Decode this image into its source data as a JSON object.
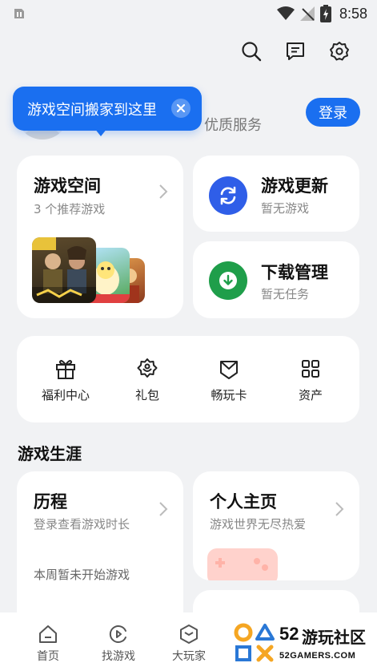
{
  "status_bar": {
    "time": "8:58"
  },
  "profile": {
    "tagline": "优质服务",
    "login_label": "登录"
  },
  "tooltip": {
    "text": "游戏空间搬家到这里"
  },
  "game_space": {
    "title": "游戏空间",
    "subtitle": "3 个推荐游戏"
  },
  "game_update": {
    "title": "游戏更新",
    "subtitle": "暂无游戏",
    "accent": "#2f5ee8"
  },
  "download_mgmt": {
    "title": "下载管理",
    "subtitle": "暂无任务",
    "accent": "#1f9e4a"
  },
  "shortcuts": [
    {
      "label": "福利中心",
      "icon": "gift-icon"
    },
    {
      "label": "礼包",
      "icon": "gift-bag-icon"
    },
    {
      "label": "畅玩卡",
      "icon": "play-card-icon"
    },
    {
      "label": "资产",
      "icon": "grid-icon"
    }
  ],
  "career": {
    "section_title": "游戏生涯",
    "history": {
      "title": "历程",
      "subtitle": "登录查看游戏时长",
      "note": "本周暂未开始游戏"
    },
    "homepage": {
      "title": "个人主页",
      "subtitle": "游戏世界无尽热爱"
    }
  },
  "bottom_nav": [
    {
      "label": "首页",
      "icon": "home-icon"
    },
    {
      "label": "找游戏",
      "icon": "find-game-icon"
    },
    {
      "label": "大玩家",
      "icon": "player-icon"
    }
  ],
  "watermark": {
    "number": "52",
    "text": "游玩社区",
    "domain": "52GAMERS.COM"
  },
  "colors": {
    "primary": "#1a6ff0",
    "background": "#f1f2f4"
  }
}
